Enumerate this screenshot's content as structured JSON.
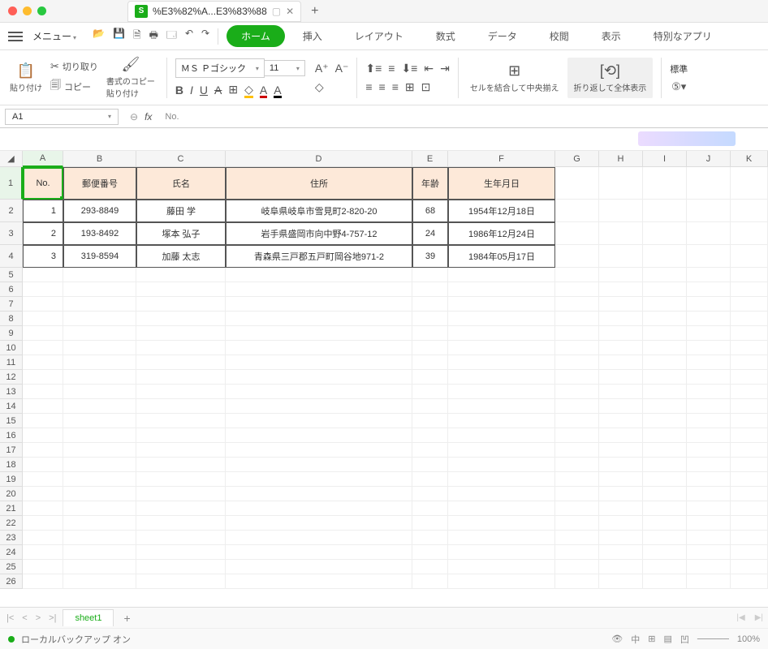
{
  "titlebar": {
    "tab_title": "%E3%82%A...E3%83%88",
    "tab_icon": "S"
  },
  "menubar": {
    "menu_label": "メニュー",
    "tabs": {
      "home": "ホーム",
      "insert": "挿入",
      "layout": "レイアウト",
      "formula": "数式",
      "data": "データ",
      "review": "校閲",
      "view": "表示",
      "special": "特別なアプリ"
    }
  },
  "ribbon": {
    "paste": "貼り付け",
    "cut": "切り取り",
    "copy": "コピー",
    "format_painter": "書式のコピー",
    "format_painter2": "貼り付け",
    "font_name": "ＭＳ Ｐゴシック",
    "font_size": "11",
    "merge": "セルを結合して中央揃え",
    "wrap": "折り返して全体表示",
    "standard": "標準"
  },
  "formula": {
    "cell_ref": "A1",
    "fx": "fx",
    "content": "No."
  },
  "sheet": {
    "cols": [
      "A",
      "B",
      "C",
      "D",
      "E",
      "F",
      "G",
      "H",
      "I",
      "J",
      "K"
    ],
    "header_row": {
      "no": "No.",
      "postal": "郵便番号",
      "name": "氏名",
      "address": "住所",
      "age": "年齢",
      "dob": "生年月日"
    },
    "rows": [
      {
        "no": "1",
        "postal": "293-8849",
        "name": "藤田 学",
        "address": "岐阜県岐阜市雪見町2-820-20",
        "age": "68",
        "dob": "1954年12月18日"
      },
      {
        "no": "2",
        "postal": "193-8492",
        "name": "塚本 弘子",
        "address": "岩手県盛岡市向中野4-757-12",
        "age": "24",
        "dob": "1986年12月24日"
      },
      {
        "no": "3",
        "postal": "319-8594",
        "name": "加藤 太志",
        "address": "青森県三戸郡五戸町岡谷地971-2",
        "age": "39",
        "dob": "1984年05月17日"
      }
    ]
  },
  "sheettabs": {
    "tab1": "sheet1"
  },
  "statusbar": {
    "backup": "ローカルバックアップ オン",
    "zoom": "100%"
  }
}
